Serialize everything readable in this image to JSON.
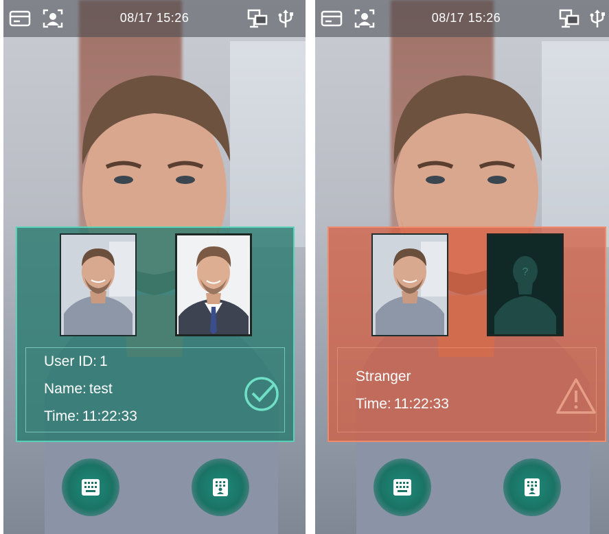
{
  "screens": [
    {
      "status_bar": {
        "time": "08/17 15:26",
        "left_icons": [
          "card-icon",
          "face-recognition-icon"
        ],
        "right_icons": [
          "network-icon",
          "usb-icon"
        ]
      },
      "result": {
        "state": "verified",
        "accent_color": "#58d3b9",
        "user_id_label": "User ID:",
        "user_id": "1",
        "name_label": "Name:",
        "name": "test",
        "time_label": "Time:",
        "time": "11:22:33",
        "status_icon": "check-circle-icon"
      },
      "buttons": [
        "keypad-icon",
        "keypad-user-icon"
      ]
    },
    {
      "status_bar": {
        "time": "08/17 15:26",
        "left_icons": [
          "card-icon",
          "face-recognition-icon"
        ],
        "right_icons": [
          "network-icon",
          "usb-icon"
        ]
      },
      "result": {
        "state": "stranger",
        "accent_color": "#f08a6a",
        "title": "Stranger",
        "time_label": "Time:",
        "time": "11:22:33",
        "status_icon": "warning-icon",
        "registered_photo_icon": "unknown-person-icon",
        "registered_photo_glyph": "?"
      },
      "buttons": [
        "keypad-icon",
        "keypad-user-icon"
      ]
    }
  ]
}
